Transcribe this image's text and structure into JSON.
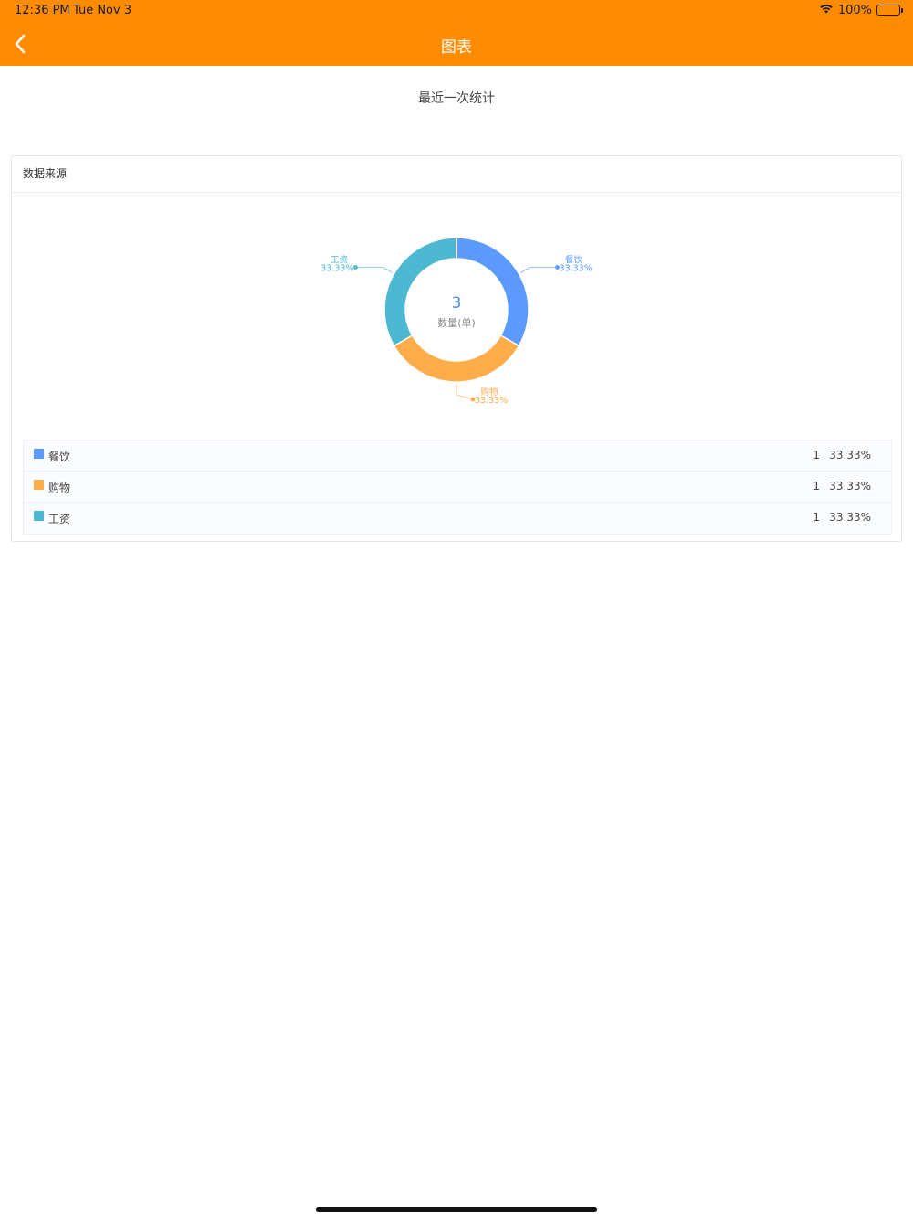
{
  "status_bar": {
    "time": "12:36 PM",
    "date": "Tue Nov 3",
    "battery": "100%",
    "wifi_icon": "wifi-icon",
    "battery_icon": "battery-icon"
  },
  "nav": {
    "title": "图表",
    "back_icon": "chevron-left-icon",
    "background": "#ff8c00"
  },
  "subtitle": "最近一次统计",
  "card": {
    "title": "数据来源"
  },
  "chart_data": {
    "type": "pie",
    "donut": true,
    "center_value": "3",
    "center_label": "数量(单)",
    "categories": [
      "餐饮",
      "购物",
      "工资"
    ],
    "values": [
      1,
      1,
      1
    ],
    "percent_labels": [
      "33.33%",
      "33.33%",
      "33.33%"
    ],
    "colors": [
      "#5b9bff",
      "#ffad4a",
      "#4db8d2"
    ],
    "center_value_color": "#4a8df0"
  },
  "legend": [
    {
      "label": "餐饮",
      "count": "1",
      "percent": "33.33%",
      "color": "#5b9bff"
    },
    {
      "label": "购物",
      "count": "1",
      "percent": "33.33%",
      "color": "#ffad4a"
    },
    {
      "label": "工资",
      "count": "1",
      "percent": "33.33%",
      "color": "#4db8d2"
    }
  ]
}
